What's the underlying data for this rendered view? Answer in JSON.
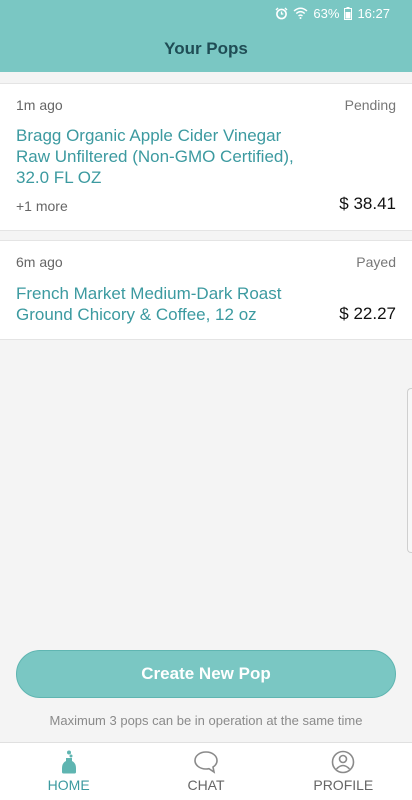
{
  "status_bar": {
    "battery_percent": "63%",
    "time": "16:27",
    "icons": [
      "alarm-icon",
      "wifi-icon",
      "battery-icon"
    ]
  },
  "header": {
    "title": "Your Pops"
  },
  "pops": [
    {
      "time_ago": "1m ago",
      "status": "Pending",
      "product": "Bragg Organic Apple Cider Vinegar Raw Unfiltered (Non-GMO Certified), 32.0 FL OZ",
      "more": "+1 more",
      "price": "$ 38.41"
    },
    {
      "time_ago": "6m ago",
      "status": "Payed",
      "product": "French Market Medium-Dark Roast Ground Chicory & Coffee, 12 oz",
      "price": "$ 22.27"
    }
  ],
  "actions": {
    "create_label": "Create New Pop",
    "limit_note": "Maximum 3 pops can be in operation at the same time"
  },
  "tabs": [
    {
      "label": "HOME",
      "icon": "pop-bottle-icon",
      "active": true
    },
    {
      "label": "CHAT",
      "icon": "chat-bubble-icon",
      "active": false
    },
    {
      "label": "PROFILE",
      "icon": "user-circle-icon",
      "active": false
    }
  ],
  "colors": {
    "accent": "#7ac7c3",
    "link_text": "#3c9aa0",
    "title_text": "#1f4d55",
    "background": "#f4f4f4"
  }
}
